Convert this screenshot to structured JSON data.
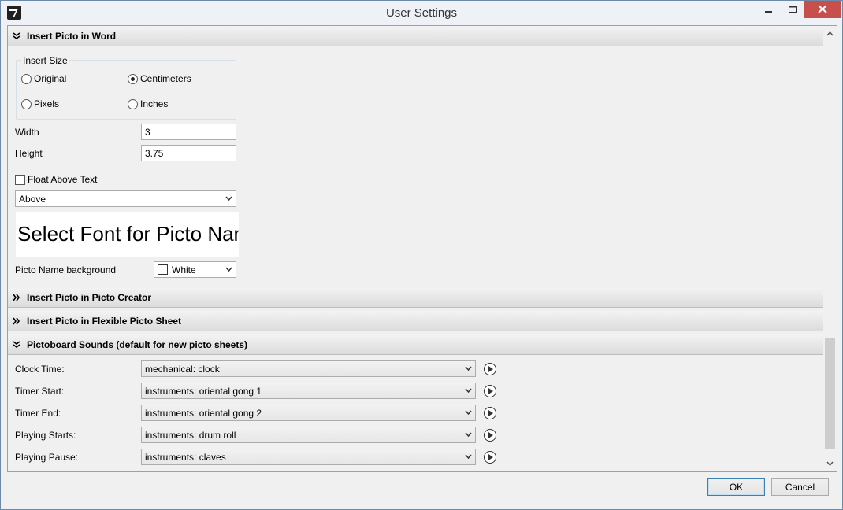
{
  "window": {
    "title": "User Settings"
  },
  "sections": {
    "word": {
      "title": "Insert Picto in Word"
    },
    "creator": {
      "title": "Insert Picto in Picto Creator"
    },
    "flexible": {
      "title": "Insert Picto in Flexible Picto Sheet"
    },
    "sounds": {
      "title": "Pictoboard Sounds (default for new picto sheets)"
    }
  },
  "insert_size": {
    "legend": "Insert Size",
    "options": [
      "Original",
      "Centimeters",
      "Pixels",
      "Inches"
    ],
    "selected": "Centimeters"
  },
  "width": {
    "label": "Width",
    "value": "3"
  },
  "height": {
    "label": "Height",
    "value": "3.75"
  },
  "float_above": {
    "label": "Float Above Text",
    "checked": false
  },
  "position_select": {
    "value": "Above"
  },
  "font_preview": {
    "text": "Select Font for Picto Name"
  },
  "name_background": {
    "label": "Picto Name background",
    "value": "White"
  },
  "sounds": [
    {
      "label": "Clock Time:",
      "value": "mechanical: clock"
    },
    {
      "label": "Timer Start:",
      "value": "instruments: oriental gong 1"
    },
    {
      "label": "Timer End:",
      "value": "instruments: oriental gong 2"
    },
    {
      "label": "Playing Starts:",
      "value": "instruments: drum roll"
    },
    {
      "label": "Playing Pause:",
      "value": "instruments: claves"
    }
  ],
  "buttons": {
    "ok": "OK",
    "cancel": "Cancel"
  },
  "icons": {
    "app": "app-logo-icon",
    "minimize": "minimize-icon",
    "maximize": "maximize-icon",
    "close": "close-icon",
    "collapse": "chevron-double-down-icon",
    "expand": "chevron-double-right-icon",
    "play": "play-icon"
  },
  "colors": {
    "close_button": "#c7504c",
    "title_bar": "#eef2f7",
    "panel": "#f0f0f0"
  }
}
